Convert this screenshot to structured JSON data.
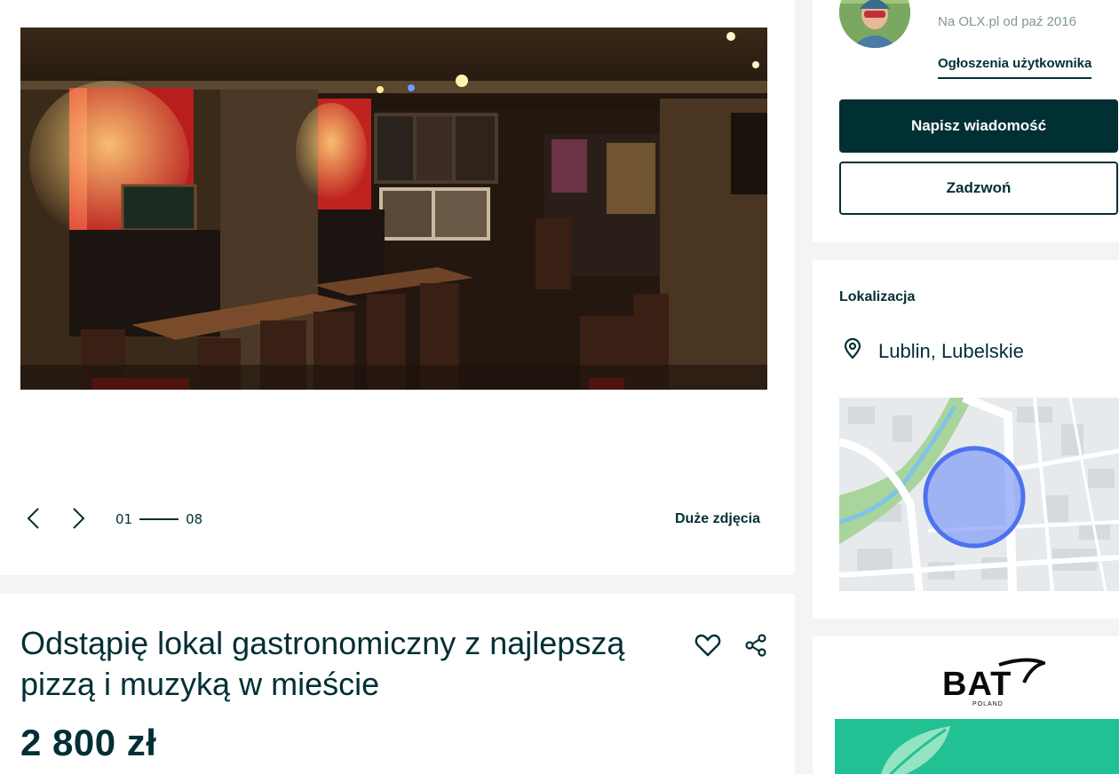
{
  "gallery": {
    "current": "01",
    "total": "08",
    "big_photos_label": "Duże zdjęcia"
  },
  "listing": {
    "title": "Odstąpię lokal gastronomiczny z najlepszą pizzą i muzyką w mieście",
    "price": "2 800 zł"
  },
  "seller": {
    "member_since": "Na OLX.pl od paź 2016",
    "user_ads_link": "Ogłoszenia użytkownika",
    "message_button": "Napisz wiadomość",
    "call_button": "Zadzwoń"
  },
  "location": {
    "heading": "Lokalizacja",
    "place": "Lublin, Lubelskie"
  },
  "ad": {
    "brand": "BAT",
    "brand_sub": "POLAND"
  },
  "icons": {
    "prev": "chevron-left-icon",
    "next": "chevron-right-icon",
    "favorite": "heart-icon",
    "share": "share-icon",
    "location": "map-pin-icon"
  },
  "colors": {
    "brand_dark": "#002f34",
    "muted_text": "#7f9799",
    "map_marker": "#5b7cf4",
    "page_bg": "#f2f4f5"
  }
}
